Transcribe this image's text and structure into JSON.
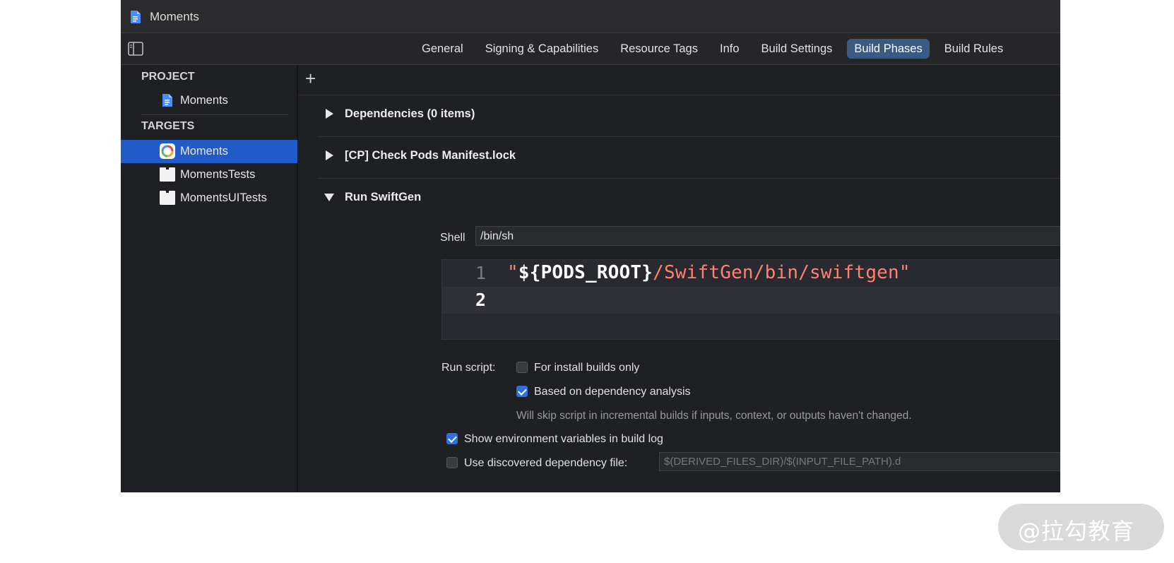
{
  "window": {
    "title": "Moments"
  },
  "tabs": [
    {
      "label": "General"
    },
    {
      "label": "Signing & Capabilities"
    },
    {
      "label": "Resource Tags"
    },
    {
      "label": "Info"
    },
    {
      "label": "Build Settings"
    },
    {
      "label": "Build Phases",
      "active": true
    },
    {
      "label": "Build Rules"
    }
  ],
  "sidebar": {
    "project_header": "PROJECT",
    "project_item": "Moments",
    "targets_header": "TARGETS",
    "targets": [
      {
        "label": "Moments",
        "selected": true,
        "icon": "app-icon"
      },
      {
        "label": "MomentsTests",
        "icon": "bundle-icon"
      },
      {
        "label": "MomentsUITests",
        "icon": "bundle-icon"
      }
    ]
  },
  "main": {
    "add_symbol": "+",
    "phases": [
      {
        "label": "Dependencies (0 items)",
        "expanded": false
      },
      {
        "label": "[CP] Check Pods Manifest.lock",
        "expanded": false
      },
      {
        "label": "Run SwiftGen",
        "expanded": true
      }
    ],
    "shell_label": "Shell",
    "shell_value": "/bin/sh",
    "script": {
      "line_numbers": [
        "1",
        "2"
      ],
      "quote_open": "\"",
      "variable": "${PODS_ROOT}",
      "path": "/SwiftGen/bin/swiftgen",
      "quote_close": "\""
    },
    "run_script_label": "Run script:",
    "options": {
      "install_builds_only": {
        "label": "For install builds only",
        "checked": false
      },
      "dependency_analysis": {
        "label": "Based on dependency analysis",
        "checked": true
      },
      "dependency_hint": "Will skip script in incremental builds if inputs, context, or outputs haven't changed.",
      "show_env_vars": {
        "label": "Show environment variables in build log",
        "checked": true
      },
      "use_dep_file": {
        "label": "Use discovered dependency file:",
        "checked": false
      }
    },
    "dep_file_placeholder": "$(DERIVED_FILES_DIR)/$(INPUT_FILE_PATH).d"
  },
  "watermark": "@拉勾教育",
  "colors": {
    "selection": "#1f5cc8",
    "active_tab": "#3a5a82",
    "checkbox_on": "#2f6fe0",
    "string": "#ff8170"
  }
}
